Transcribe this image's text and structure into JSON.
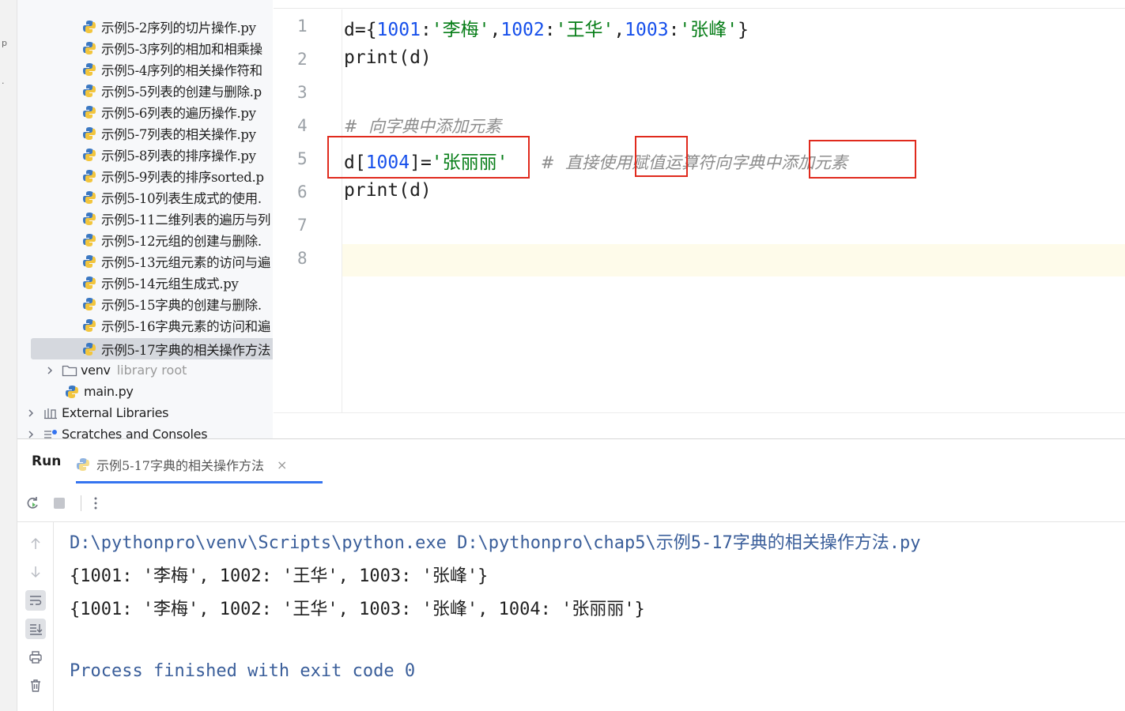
{
  "project_tree": {
    "files": [
      {
        "label": "示例5-2序列的切片操作.py"
      },
      {
        "label": "示例5-3序列的相加和相乘操"
      },
      {
        "label": "示例5-4序列的相关操作符和"
      },
      {
        "label": "示例5-5列表的创建与删除.p"
      },
      {
        "label": "示例5-6列表的遍历操作.py"
      },
      {
        "label": "示例5-7列表的相关操作.py"
      },
      {
        "label": "示例5-8列表的排序操作.py"
      },
      {
        "label": "示例5-9列表的排序sorted.p"
      },
      {
        "label": "示例5-10列表生成式的使用."
      },
      {
        "label": "示例5-11二维列表的遍历与列"
      },
      {
        "label": "示例5-12元组的创建与删除."
      },
      {
        "label": "示例5-13元组元素的访问与遍"
      },
      {
        "label": "示例5-14元组生成式.py"
      },
      {
        "label": "示例5-15字典的创建与删除."
      },
      {
        "label": "示例5-16字典元素的访问和遍"
      },
      {
        "label": "示例5-17字典的相关操作方法"
      }
    ],
    "venv": {
      "label": "venv",
      "sublabel": "library root"
    },
    "main_py": {
      "label": "main.py"
    },
    "external_libraries": {
      "label": "External Libraries"
    },
    "scratches": {
      "label": "Scratches and Consoles"
    }
  },
  "editor": {
    "line_numbers": [
      "1",
      "2",
      "3",
      "4",
      "5",
      "6",
      "7",
      "8"
    ],
    "line1": {
      "p1": "d={",
      "n1": "1001",
      "p2": ":",
      "s1": "'李梅'",
      "p3": ",",
      "n2": "1002",
      "p4": ":",
      "s2": "'王华'",
      "p5": ",",
      "n3": "1003",
      "p6": ":",
      "s3": "'张峰'",
      "p7": "}"
    },
    "line2": "print(d)",
    "line4_comment": "#  向字典中添加元素",
    "line5": {
      "p1": "d[",
      "n1": "1004",
      "p2": "]=",
      "s1": "'张丽丽'",
      "comment": "#  直接使用赋值运算符向字典中添加元素"
    },
    "line6": "print(d)",
    "highlight_color": "#e02a1d"
  },
  "run_panel": {
    "title": "Run",
    "tab_label": "示例5-17字典的相关操作方法",
    "tab_close": "×",
    "console": {
      "command": "D:\\pythonpro\\venv\\Scripts\\python.exe D:\\pythonpro\\chap5\\示例5-17字典的相关操作方法.py",
      "output1": "{1001: '李梅', 1002: '王华', 1003: '张峰'}",
      "output2": "{1001: '李梅', 1002: '王华', 1003: '张峰', 1004: '张丽丽'}",
      "exit": "Process finished with exit code 0"
    }
  }
}
